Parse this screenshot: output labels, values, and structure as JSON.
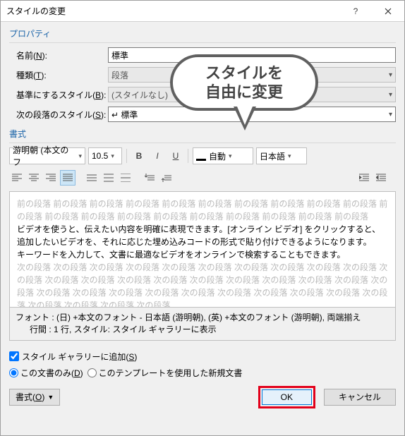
{
  "titlebar": {
    "title": "スタイルの変更"
  },
  "groups": {
    "properties": "プロパティ",
    "format": "書式"
  },
  "rows": {
    "name": {
      "label": "名前(N):",
      "value": "標準"
    },
    "type": {
      "label": "種類(T):",
      "value": "段落"
    },
    "based": {
      "label": "基準にするスタイル(B):",
      "value": "(スタイルなし)"
    },
    "next": {
      "label": "次の段落のスタイル(S):",
      "value": "↵ 標準"
    }
  },
  "format": {
    "font": "游明朝 (本文のフ",
    "size": "10.5",
    "color": "自動",
    "lang": "日本語"
  },
  "preview": {
    "ghost": "前の段落 前の段落 前の段落 前の段落 前の段落 前の段落 前の段落 前の段落 前の段落 前の段落 前の段落 前の段落 前の段落 前の段落 前の段落 前の段落 前の段落 前の段落 前の段落 前の段落",
    "line1": "ビデオを使うと、伝えたい内容を明確に表現できます。[オンライン ビデオ] をクリックすると、",
    "line2": "追加したいビデオを、それに応じた埋め込みコードの形式で貼り付けできるようになります。",
    "line3": "キーワードを入力して、文書に最適なビデオをオンラインで検索することもできます。",
    "ghost2": "次の段落 次の段落 次の段落 次の段落 次の段落 次の段落 次の段落 次の段落 次の段落 次の段落 次の段落 次の段落 次の段落 次の段落 次の段落 次の段落 次の段落 次の段落 次の段落 次の段落 次の段落 次の段落 次の段落 次の段落 次の段落 次の段落 次の段落 次の段落 次の段落 次の段落 次の段落 次の段落 次の段落 次の段落 次の段落"
  },
  "desc": {
    "line1": "フォント : (日) +本文のフォント - 日本語 (游明朝), (英) +本文のフォント (游明朝), 両端揃え",
    "line2": "行間 :  1 行, スタイル: スタイル ギャラリーに表示"
  },
  "options": {
    "gallery": "スタイル ギャラリーに追加(S)",
    "thisdoc": "この文書のみ(D)",
    "template": "このテンプレートを使用した新規文書"
  },
  "buttons": {
    "format_menu": "書式(O)",
    "ok": "OK",
    "cancel": "キャンセル"
  },
  "callout": "スタイルを\n自由に変更"
}
